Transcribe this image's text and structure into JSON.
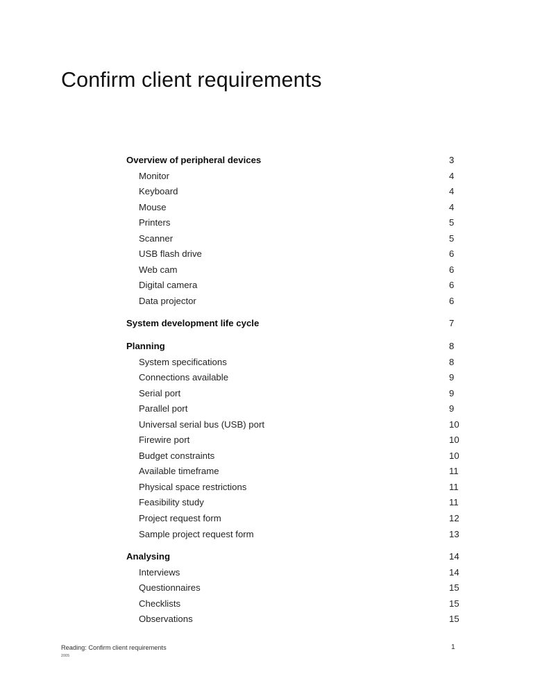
{
  "document": {
    "title": "Confirm client requirements"
  },
  "toc": {
    "entries": [
      {
        "label": "Overview of peripheral devices",
        "page": "3",
        "level": 1
      },
      {
        "label": "Monitor",
        "page": "4",
        "level": 2
      },
      {
        "label": "Keyboard",
        "page": "4",
        "level": 2
      },
      {
        "label": "Mouse",
        "page": "4",
        "level": 2
      },
      {
        "label": "Printers",
        "page": "5",
        "level": 2
      },
      {
        "label": "Scanner",
        "page": "5",
        "level": 2
      },
      {
        "label": "USB flash drive",
        "page": "6",
        "level": 2
      },
      {
        "label": "Web cam",
        "page": "6",
        "level": 2
      },
      {
        "label": "Digital camera",
        "page": "6",
        "level": 2
      },
      {
        "label": "Data projector",
        "page": "6",
        "level": 2
      },
      {
        "label": "System development life cycle",
        "page": "7",
        "level": 1
      },
      {
        "label": "Planning",
        "page": "8",
        "level": 1
      },
      {
        "label": "System specifications",
        "page": "8",
        "level": 2
      },
      {
        "label": "Connections available",
        "page": "9",
        "level": 2
      },
      {
        "label": "Serial port",
        "page": "9",
        "level": 2
      },
      {
        "label": "Parallel port",
        "page": "9",
        "level": 2
      },
      {
        "label": "Universal serial bus (USB) port",
        "page": "10",
        "level": 2
      },
      {
        "label": "Firewire port",
        "page": "10",
        "level": 2
      },
      {
        "label": "Budget constraints",
        "page": "10",
        "level": 2
      },
      {
        "label": "Available timeframe",
        "page": "11",
        "level": 2
      },
      {
        "label": "Physical space restrictions",
        "page": "11",
        "level": 2
      },
      {
        "label": "Feasibility study",
        "page": "11",
        "level": 2
      },
      {
        "label": "Project request form",
        "page": "12",
        "level": 2
      },
      {
        "label": "Sample project request form",
        "page": "13",
        "level": 2
      },
      {
        "label": "Analysing",
        "page": "14",
        "level": 1
      },
      {
        "label": "Interviews",
        "page": "14",
        "level": 2
      },
      {
        "label": "Questionnaires",
        "page": "15",
        "level": 2
      },
      {
        "label": "Checklists",
        "page": "15",
        "level": 2
      },
      {
        "label": "Observations",
        "page": "15",
        "level": 2
      }
    ]
  },
  "footer": {
    "text": "Reading: Confirm client requirements",
    "year": "2005",
    "page_number": "1"
  }
}
